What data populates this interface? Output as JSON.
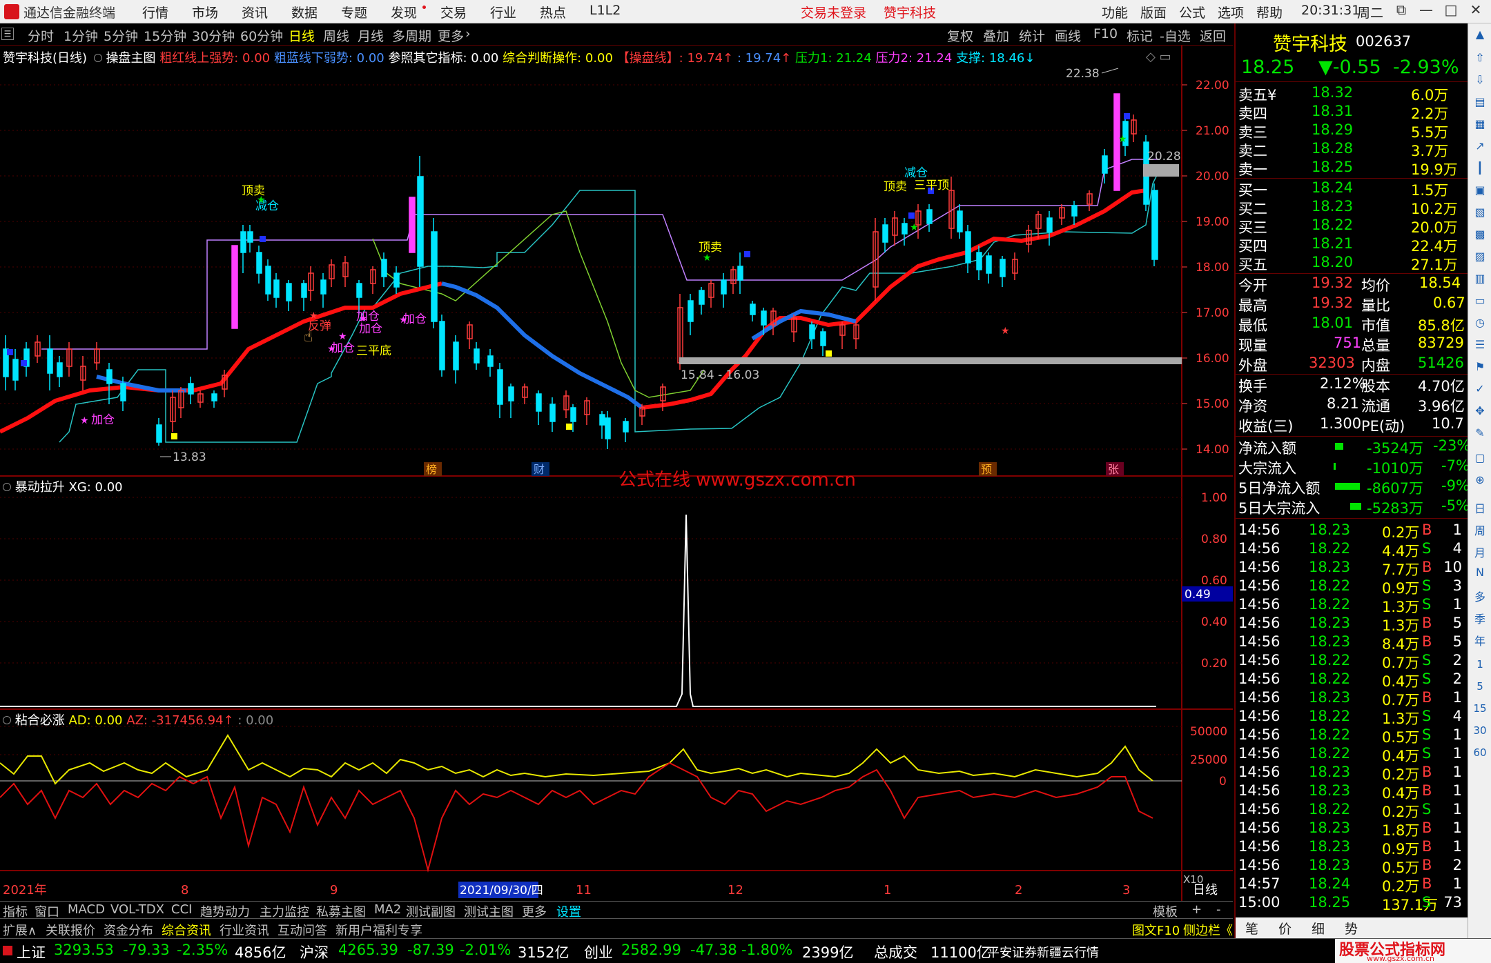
{
  "app": {
    "name": "通达信金融终端",
    "menu": [
      "行情",
      "市场",
      "资讯",
      "数据",
      "专题",
      "发现",
      "交易",
      "行业",
      "热点",
      "L1L2"
    ],
    "login": "交易未登录",
    "stock_short": "赞宇科技",
    "right_menu": [
      "功能",
      "版面",
      "公式",
      "选项",
      "帮助"
    ],
    "time": "20:31:31",
    "weekday": "周二"
  },
  "periods": [
    "分时",
    "1分钟",
    "5分钟",
    "15分钟",
    "30分钟",
    "60分钟",
    "日线",
    "周线",
    "月线",
    "多周期",
    "更多"
  ],
  "toolbar": [
    "复权",
    "叠加",
    "统计",
    "画线",
    "F10",
    "标记",
    "-自选",
    "返回"
  ],
  "main_info": {
    "stock": "赞宇科技(日线)",
    "chart": "操盘主图",
    "s1": "粗红线上强势: 0.00",
    "s2": "粗蓝线下弱势: 0.00",
    "s3": "参照其它指标: 0.00",
    "s4": "综合判断操作: 0.00",
    "s5": "【操盘线】: 19.74",
    "s6": ": 19.74",
    "s7": "压力1: 21.24",
    "s8": "压力2: 21.24",
    "s9": "支撑: 18.46"
  },
  "price_axis": [
    "22.00",
    "21.00",
    "20.00",
    "19.00",
    "18.00",
    "17.00",
    "16.00",
    "15.00",
    "14.00"
  ],
  "labels": {
    "high": "22.38",
    "low": "13.83",
    "gap1": "20.28",
    "gap2": "15.84 - 16.03",
    "bang": "榜",
    "cai": "财",
    "yu": "预",
    "zhang": "张",
    "watermark": "公式在线  www.gszx.com.cn"
  },
  "signals": [
    "顶卖",
    "减仓",
    "加仓",
    "加仓",
    "反弹",
    "加仓",
    "加仓",
    "三平底",
    "加仓",
    "顶卖",
    "顶卖",
    "减仓",
    "三平顶"
  ],
  "ind1": {
    "name": "暴动拉升",
    "val": "XG: 0.00",
    "axis": [
      "1.00",
      "0.80",
      "0.60",
      "0.40",
      "0.20"
    ],
    "marker": "0.49"
  },
  "ind2": {
    "name": "粘合必涨",
    "ad": "AD: 0.00",
    "az": "AZ: -317456.94",
    "extra": ": 0.00",
    "axis": [
      "50000",
      "25000",
      "0"
    ]
  },
  "date_axis": [
    "2021年",
    "8",
    "9",
    "2021/09/30/四",
    "11",
    "12",
    "1",
    "2",
    "3",
    "日线"
  ],
  "x10": "X10",
  "tabs1": [
    "指标",
    "窗口",
    "MACD",
    "VOL-TDX",
    "CCI",
    "趋势动力",
    "主力监控",
    "私募主图",
    "MA2",
    "测试副图",
    "测试主图",
    "更多",
    "设置"
  ],
  "tabs1_right": [
    "模板",
    "+",
    "-"
  ],
  "tabs2": [
    "扩展∧",
    "关联报价",
    "资金分布",
    "综合资讯",
    "行业资讯",
    "互动问答",
    "新用户福利专享"
  ],
  "tabs2_right": [
    "图文F10",
    "侧边栏《"
  ],
  "quote": {
    "name": "赞宇科技",
    "code": "002637",
    "price": "18.25",
    "change": "▼-0.55",
    "pct": "-2.93%",
    "asks": [
      [
        "卖五¥",
        "18.32",
        "6.0万"
      ],
      [
        "卖四",
        "18.31",
        "2.2万"
      ],
      [
        "卖三",
        "18.29",
        "5.5万"
      ],
      [
        "卖二",
        "18.28",
        "3.7万"
      ],
      [
        "卖一",
        "18.25",
        "19.9万"
      ]
    ],
    "bids": [
      [
        "买一",
        "18.24",
        "1.5万"
      ],
      [
        "买二",
        "18.23",
        "10.2万"
      ],
      [
        "买三",
        "18.22",
        "20.0万"
      ],
      [
        "买四",
        "18.21",
        "22.4万"
      ],
      [
        "买五",
        "18.20",
        "27.1万"
      ]
    ],
    "stats": [
      [
        "今开",
        "19.32",
        "均价",
        "18.54"
      ],
      [
        "最高",
        "19.32",
        "量比",
        "0.67"
      ],
      [
        "最低",
        "18.01",
        "市值",
        "85.8亿"
      ],
      [
        "现量",
        "751",
        "总量",
        "83729"
      ],
      [
        "外盘",
        "32303",
        "内盘",
        "51426"
      ],
      [
        "换手",
        "2.12%",
        "股本",
        "4.70亿"
      ],
      [
        "净资",
        "8.21",
        "流通",
        "3.96亿"
      ],
      [
        "收益(三)",
        "1.300",
        "PE(动)",
        "10.7"
      ]
    ],
    "flows": [
      [
        "净流入额",
        "-3524万",
        "-23%"
      ],
      [
        "大宗流入",
        "-1010万",
        "-7%"
      ],
      [
        "5日净流入额",
        "-8607万",
        "-9%"
      ],
      [
        "5日大宗流入",
        "-5283万",
        "-5%"
      ]
    ],
    "ticks": [
      [
        "14:56",
        "18.23",
        "0.2万",
        "B",
        "1"
      ],
      [
        "14:56",
        "18.22",
        "4.4万",
        "S",
        "4"
      ],
      [
        "14:56",
        "18.23",
        "7.7万",
        "B",
        "10"
      ],
      [
        "14:56",
        "18.22",
        "0.9万",
        "S",
        "3"
      ],
      [
        "14:56",
        "18.22",
        "1.3万",
        "S",
        "1"
      ],
      [
        "14:56",
        "18.23",
        "1.3万",
        "B",
        "5"
      ],
      [
        "14:56",
        "18.23",
        "8.4万",
        "B",
        "5"
      ],
      [
        "14:56",
        "18.22",
        "0.7万",
        "S",
        "2"
      ],
      [
        "14:56",
        "18.22",
        "0.4万",
        "S",
        "2"
      ],
      [
        "14:56",
        "18.23",
        "0.7万",
        "B",
        "1"
      ],
      [
        "14:56",
        "18.22",
        "1.3万",
        "S",
        "4"
      ],
      [
        "14:56",
        "18.22",
        "0.5万",
        "S",
        "1"
      ],
      [
        "14:56",
        "18.22",
        "0.4万",
        "S",
        "1"
      ],
      [
        "14:56",
        "18.23",
        "0.2万",
        "B",
        "1"
      ],
      [
        "14:56",
        "18.23",
        "0.4万",
        "B",
        "1"
      ],
      [
        "14:56",
        "18.22",
        "0.2万",
        "S",
        "1"
      ],
      [
        "14:56",
        "18.23",
        "1.8万",
        "B",
        "1"
      ],
      [
        "14:56",
        "18.23",
        "0.9万",
        "B",
        "1"
      ],
      [
        "14:56",
        "18.23",
        "0.5万",
        "B",
        "2"
      ],
      [
        "14:57",
        "18.24",
        "0.2万",
        "B",
        "1"
      ],
      [
        "15:00",
        "18.25",
        "137.1万",
        "S",
        "73"
      ]
    ],
    "tabs": [
      "笔",
      "价",
      "细",
      "势"
    ]
  },
  "toolstrip": [
    "日",
    "周",
    "月",
    "N",
    "多",
    "季",
    "年",
    "1",
    "5",
    "15",
    "30",
    "60"
  ],
  "status": {
    "sh_name": "上证",
    "sh": "3293.53",
    "sh_chg": "-79.33",
    "sh_pct": "-2.35%",
    "sh_amt": "4856亿",
    "sz_name": "沪深",
    "sz": "4265.39",
    "sz_chg": "-87.39",
    "sz_pct": "-2.01%",
    "sz_amt": "3152亿",
    "cy_name": "创业",
    "cy": "2582.99",
    "cy_chg": "-47.38",
    "cy_pct": "-1.80%",
    "cy_amt": "2399亿",
    "total_label": "总成交",
    "total": "11100亿",
    "broker": "平安证券新疆云行情",
    "site_logo": "股票公式指标网",
    "site_url": "www.gszx.com.cn"
  },
  "colors": {
    "up": "#ff3b3b",
    "down": "#00e5ff",
    "line_red": "#ff1010",
    "line_blue": "#1e6fe8",
    "bg": "#000000",
    "panel_border": "#600000"
  },
  "chart_data": {
    "type": "candlestick",
    "ticker": "002637",
    "period": "daily",
    "y_range": [
      13.5,
      22.6
    ],
    "x_start": "2021",
    "key_prices": {
      "high": 22.38,
      "low": 13.83,
      "last": 18.25
    }
  }
}
